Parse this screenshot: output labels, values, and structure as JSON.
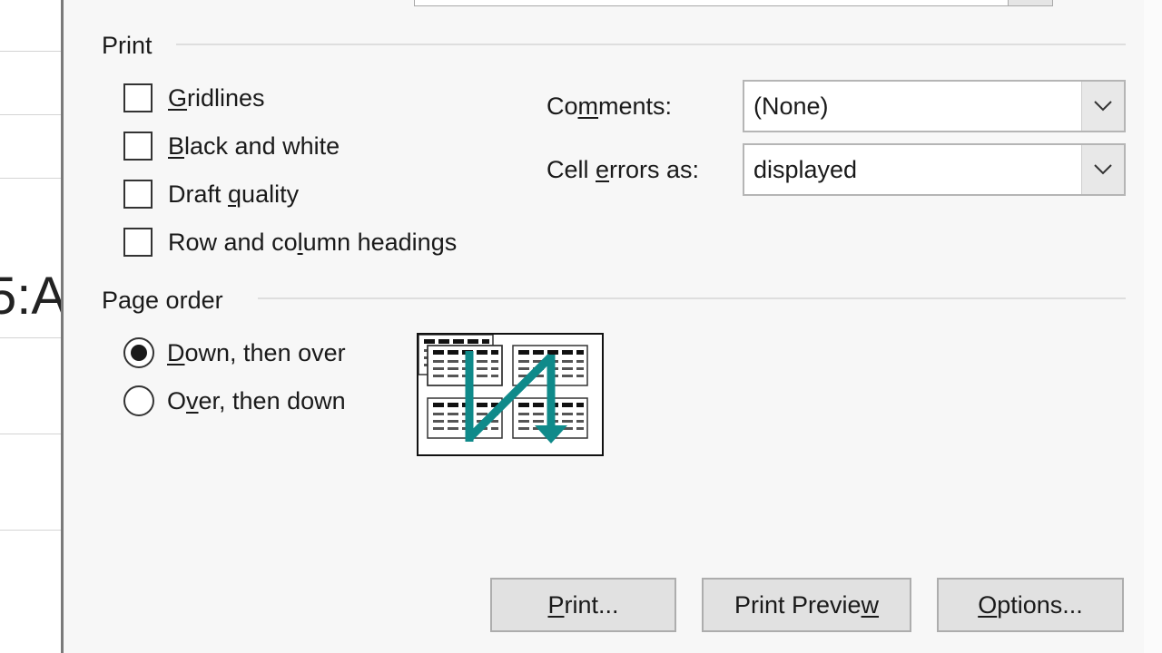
{
  "background_sheet": {
    "partial_text": "5:A"
  },
  "print_group": {
    "title": "Print",
    "checkboxes": [
      {
        "pre": "",
        "key": "G",
        "post": "ridlines",
        "checked": false
      },
      {
        "pre": "",
        "key": "B",
        "post": "lack and white",
        "checked": false
      },
      {
        "pre": "Draft ",
        "key": "q",
        "post": "uality",
        "checked": false
      },
      {
        "pre": "Row and co",
        "key": "l",
        "post": "umn headings",
        "checked": false
      }
    ],
    "comments": {
      "label_pre": "Co",
      "label_key": "m",
      "label_post": "ments:",
      "value": "(None)"
    },
    "cell_errors": {
      "label_pre": "Cell ",
      "label_key": "e",
      "label_post": "rrors as:",
      "value": "displayed"
    }
  },
  "page_order_group": {
    "title": "Page order",
    "options": [
      {
        "pre": "",
        "key": "D",
        "post": "own, then over",
        "selected": true
      },
      {
        "pre": "O",
        "key": "v",
        "post": "er, then down",
        "selected": false
      }
    ]
  },
  "buttons": {
    "print": {
      "pre": "",
      "key": "P",
      "post": "rint..."
    },
    "print_preview": {
      "pre": "Print Previe",
      "key": "w",
      "post": ""
    },
    "options": {
      "pre": "",
      "key": "O",
      "post": "ptions..."
    }
  },
  "colors": {
    "arrow": "#0f8a8a",
    "dialog_bg": "#f7f7f7",
    "button_bg": "#e1e1e1"
  }
}
